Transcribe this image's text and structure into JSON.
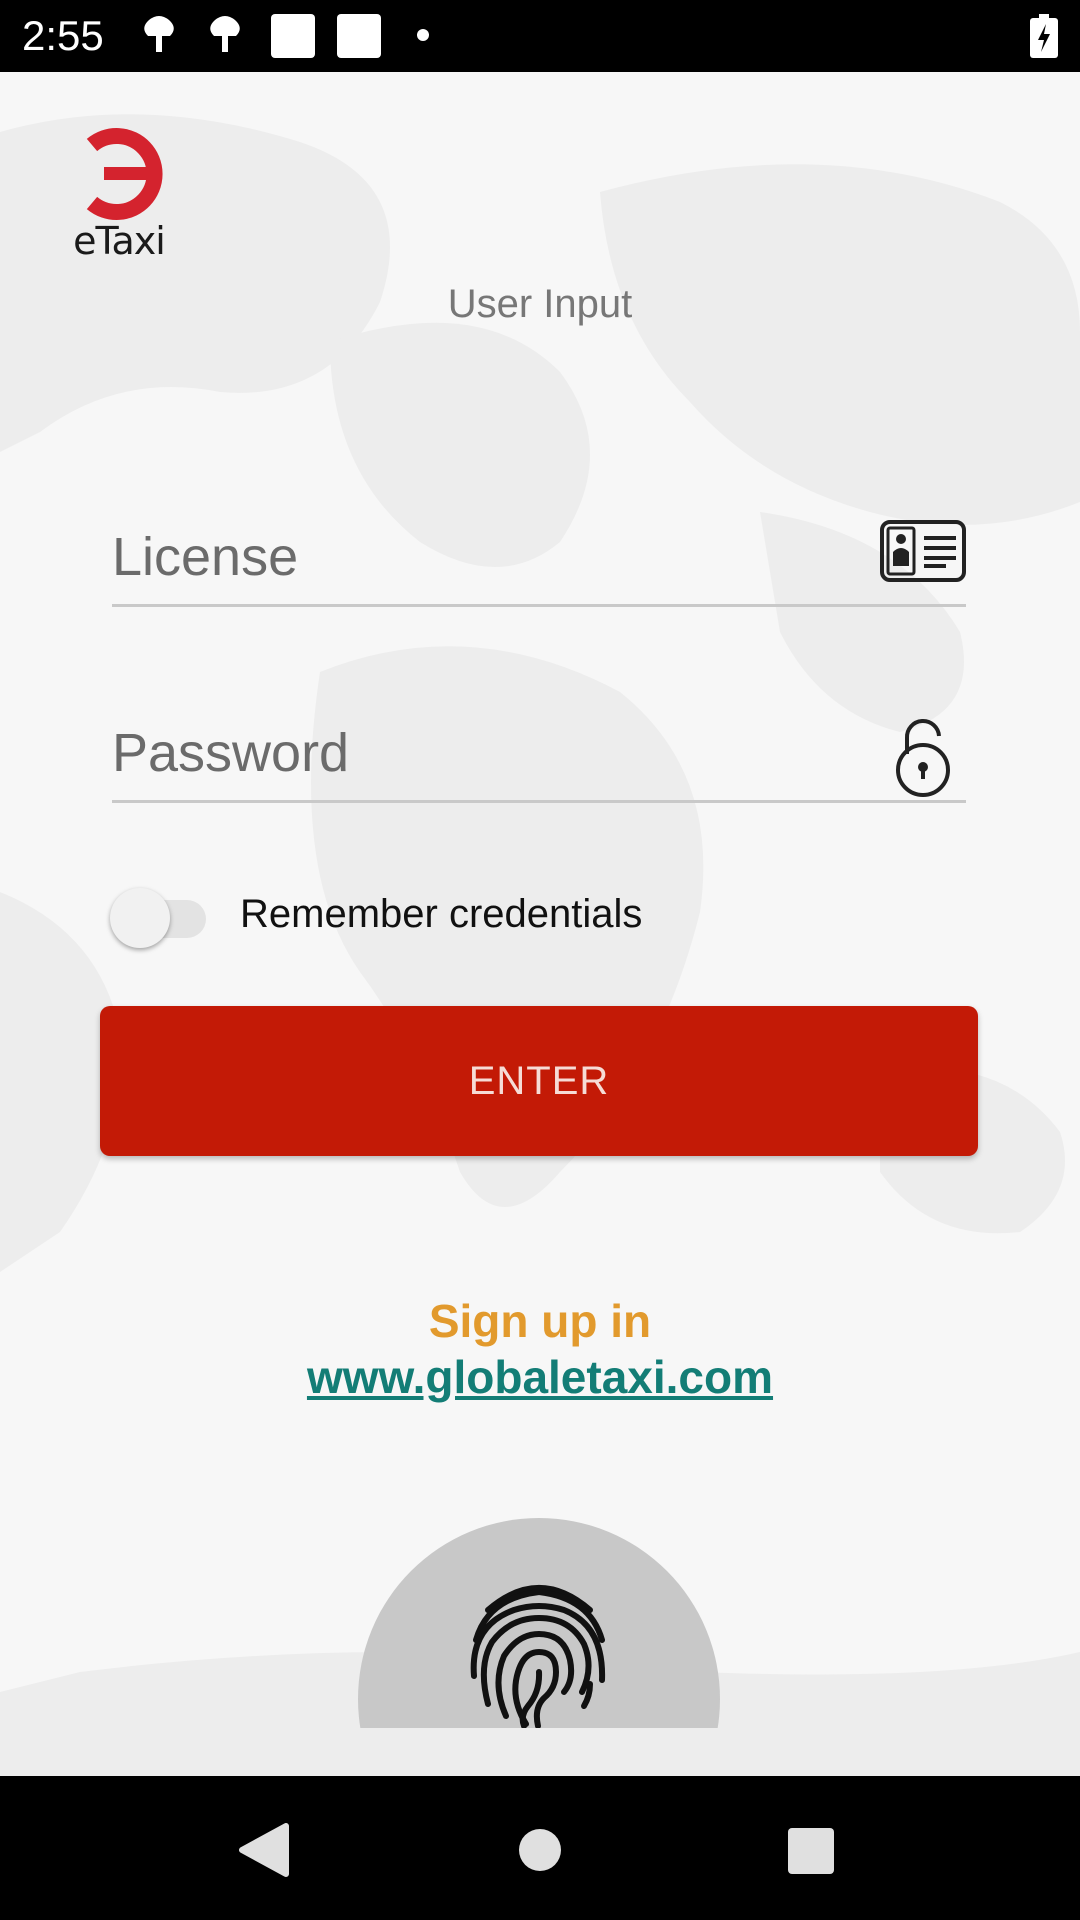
{
  "status_bar": {
    "time": "2:55",
    "icons": [
      "notification-icon",
      "notification-icon",
      "square-icon",
      "square-icon",
      "dot-icon",
      "battery-charging-icon"
    ]
  },
  "logo": {
    "text": "eTaxi",
    "color": "#d4232e"
  },
  "page_title": "User Input",
  "license_field": {
    "placeholder": "License",
    "value": "",
    "icon": "id-card-icon"
  },
  "password_field": {
    "placeholder": "Password",
    "value": "",
    "icon": "unlock-icon"
  },
  "remember_toggle": {
    "label": "Remember credentials",
    "checked": false
  },
  "enter_button": {
    "label": "ENTER",
    "color": "#c31a06"
  },
  "signup": {
    "text": "Sign up in",
    "link": "www.globaletaxi.com",
    "text_color": "#e29a2d",
    "link_color": "#137d76"
  },
  "fingerprint_button": {
    "icon": "fingerprint-icon"
  },
  "nav_bar": {
    "buttons": [
      "back-icon",
      "home-icon",
      "recents-icon"
    ]
  }
}
